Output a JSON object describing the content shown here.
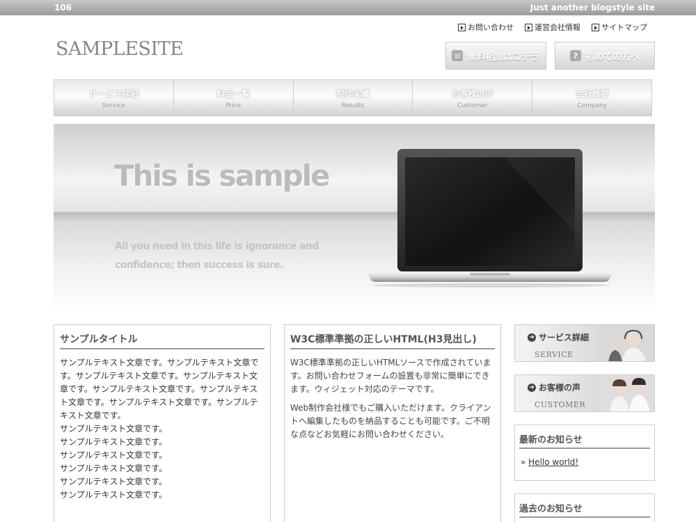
{
  "topbar": {
    "number": "106",
    "tagline": "Just another blogstyle site"
  },
  "header_links": [
    {
      "label": "お問い合わせ"
    },
    {
      "label": "運営会社情報"
    },
    {
      "label": "サイトマップ"
    }
  ],
  "logo": "SAMPLESITE",
  "cta": {
    "consult": "無料相談はコチラ",
    "first": "初めての方へ"
  },
  "nav": [
    {
      "jp": "サービス詳細",
      "en": "Service"
    },
    {
      "jp": "料金一覧",
      "en": "Price"
    },
    {
      "jp": "制作実績",
      "en": "Results"
    },
    {
      "jp": "お客様の声",
      "en": "Customer"
    },
    {
      "jp": "会社概要",
      "en": "Company"
    }
  ],
  "hero": {
    "title": "This is sample",
    "subtitle": "All you need in this life is ignorance and confidence; then success is sure."
  },
  "col1": {
    "title": "サンプルタイトル",
    "paragraph": "サンプルテキスト文章です。サンプルテキスト文章です。サンプルテキスト文章です。サンプルテキスト文章です。サンプルテキスト文章です。サンプルテキスト文章です。サンプルテキスト文章です。サンプルテキスト文章です。",
    "lines": [
      "サンプルテキスト文章です。",
      "サンプルテキスト文章です。",
      "サンプルテキスト文章です。",
      "サンプルテキスト文章です。",
      "サンプルテキスト文章です。",
      "サンプルテキスト文章です。"
    ]
  },
  "col2": {
    "title": "W3C標準準拠の正しいHTML(H3見出し)",
    "p1": "W3C標準準拠の正しいHTMLソースで作成されています。お問い合わせフォームの設置も非常に簡単にできます。ウィジェット対応のテーマです。",
    "p2": "Web制作会社様でもご購入いただけます。クライアントへ編集したものを納品することも可能です。ご不明な点などお気軽にお問い合わせください。"
  },
  "sidebar": {
    "banner1": {
      "title": "サービス詳細",
      "sub": "SERVICE"
    },
    "banner2": {
      "title": "お客様の声",
      "sub": "CUSTOMER"
    },
    "news": {
      "title": "最新のお知らせ",
      "item": "Hello world!"
    },
    "archive": {
      "title": "過去のお知らせ"
    }
  },
  "icon_names": [
    "link-arrow-icon",
    "phone-icon",
    "question-icon",
    "laptop-image",
    "arrow-circle-icon"
  ]
}
